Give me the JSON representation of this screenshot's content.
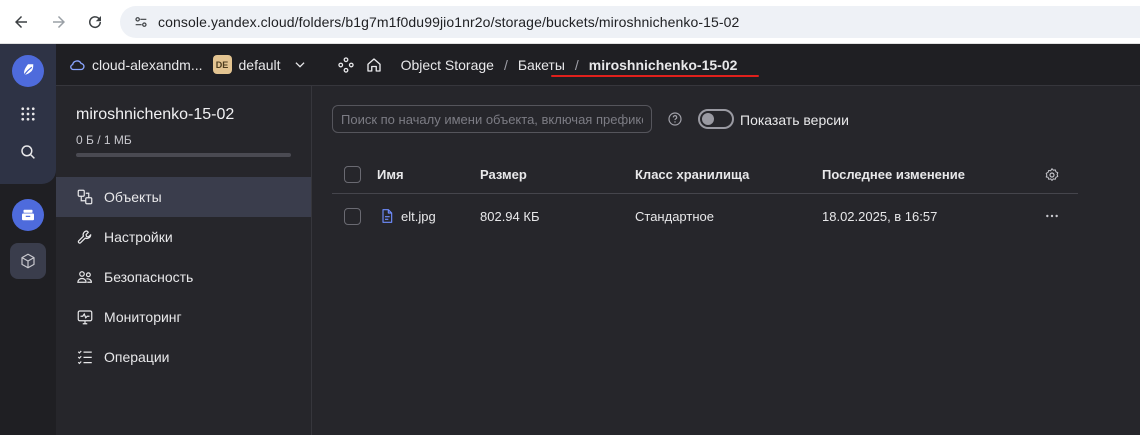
{
  "browser": {
    "url": "console.yandex.cloud/folders/b1g7m1f0du99jio1nr2o/storage/buckets/miroshnichenko-15-02"
  },
  "header": {
    "cloud_name": "cloud-alexandm...",
    "folder_badge": "DE",
    "folder_name": "default",
    "breadcrumbs": [
      "Object Storage",
      "Бакеты",
      "miroshnichenko-15-02"
    ],
    "separator": "/"
  },
  "sidebar": {
    "bucket_name": "miroshnichenko-15-02",
    "usage": "0 Б / 1 МБ",
    "usage_fraction": 0,
    "items": [
      {
        "label": "Объекты",
        "icon": "objects-icon",
        "active": true
      },
      {
        "label": "Настройки",
        "icon": "wrench-icon",
        "active": false
      },
      {
        "label": "Безопасность",
        "icon": "users-icon",
        "active": false
      },
      {
        "label": "Мониторинг",
        "icon": "monitor-icon",
        "active": false
      },
      {
        "label": "Операции",
        "icon": "list-icon",
        "active": false
      }
    ]
  },
  "toolbar": {
    "search_placeholder": "Поиск по началу имени объекта, включая префикс",
    "search_value": "",
    "show_versions_label": "Показать версии",
    "show_versions_on": false
  },
  "table": {
    "columns": [
      "Имя",
      "Размер",
      "Класс хранилища",
      "Последнее изменение"
    ],
    "rows": [
      {
        "name": "elt.jpg",
        "size": "802.94 КБ",
        "storage_class": "Стандартное",
        "modified": "18.02.2025, в 16:57"
      }
    ]
  },
  "colors": {
    "accent": "#4e6bdc",
    "underline": "#e0201c",
    "background": "#26262b"
  }
}
